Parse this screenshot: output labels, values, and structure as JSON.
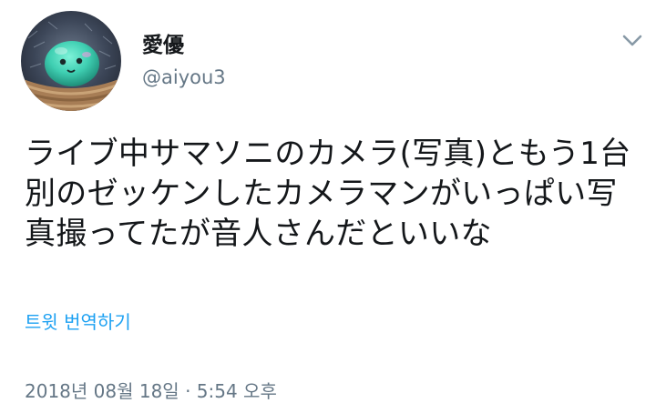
{
  "user": {
    "display_name": "愛優",
    "handle": "@aiyou3",
    "avatar_icon": "green-blob-plush-avatar"
  },
  "menu": {
    "icon": "chevron-down-icon"
  },
  "tweet": {
    "text_lines": [
      "ライブ中サマソニのカメラ(写真)ともう1台",
      "別のゼッケンしたカメラマンがいっぱい写",
      "真撮ってたが音人さんだといいな"
    ]
  },
  "translate": {
    "label": "트윗 번역하기"
  },
  "meta": {
    "timestamp": "2018년 08월 18일 · 5:54 오후"
  },
  "colors": {
    "text": "#14171a",
    "secondary": "#657786",
    "link": "#1da1f2",
    "background": "#ffffff"
  }
}
